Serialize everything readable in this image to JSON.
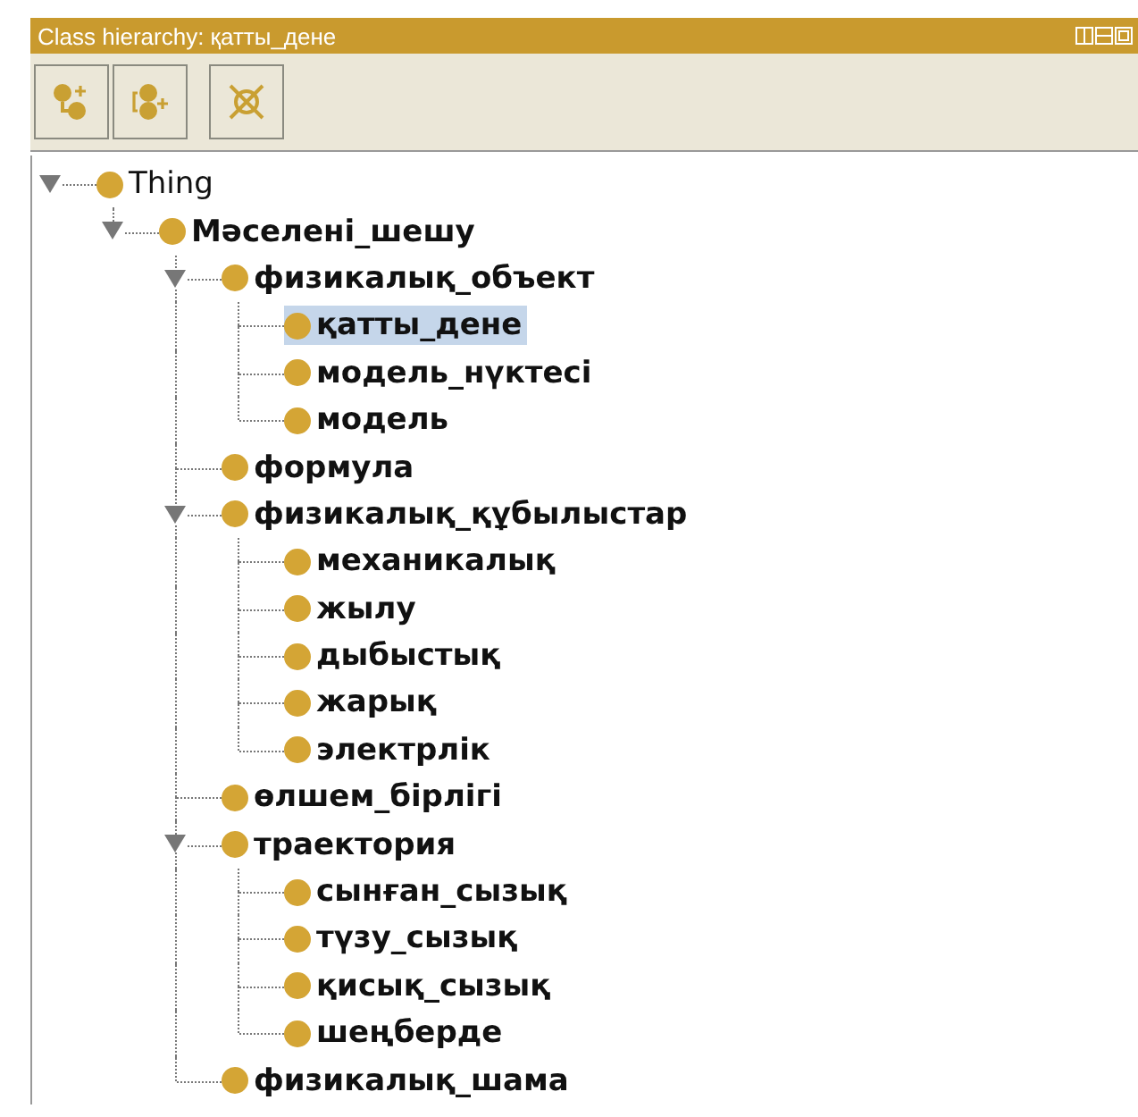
{
  "window": {
    "title": "Class hierarchy: қатты_дене"
  },
  "tree": [
    {
      "label": "Thing",
      "selected": false,
      "expanded": true,
      "children": [
        {
          "label": "Мәселені_шешу",
          "selected": false,
          "expanded": true,
          "children": [
            {
              "label": "физикалық_объект",
              "selected": false,
              "expanded": true,
              "children": [
                {
                  "label": "қатты_дене",
                  "selected": true
                },
                {
                  "label": "модель_нүктесі",
                  "selected": false
                },
                {
                  "label": "модель",
                  "selected": false
                }
              ]
            },
            {
              "label": "формула",
              "selected": false
            },
            {
              "label": "физикалық_құбылыстар",
              "selected": false,
              "expanded": true,
              "children": [
                {
                  "label": "механикалық",
                  "selected": false
                },
                {
                  "label": "жылу",
                  "selected": false
                },
                {
                  "label": "дыбыстық",
                  "selected": false
                },
                {
                  "label": "жарық",
                  "selected": false
                },
                {
                  "label": "электрлік",
                  "selected": false
                }
              ]
            },
            {
              "label": "өлшем_бірлігі",
              "selected": false
            },
            {
              "label": "траектория",
              "selected": false,
              "expanded": true,
              "children": [
                {
                  "label": "сынған_сызық",
                  "selected": false
                },
                {
                  "label": "түзу_сызық",
                  "selected": false
                },
                {
                  "label": "қисық_сызық",
                  "selected": false
                },
                {
                  "label": "шеңберде",
                  "selected": false
                }
              ]
            },
            {
              "label": "физикалық_шама",
              "selected": false
            }
          ]
        }
      ]
    }
  ]
}
